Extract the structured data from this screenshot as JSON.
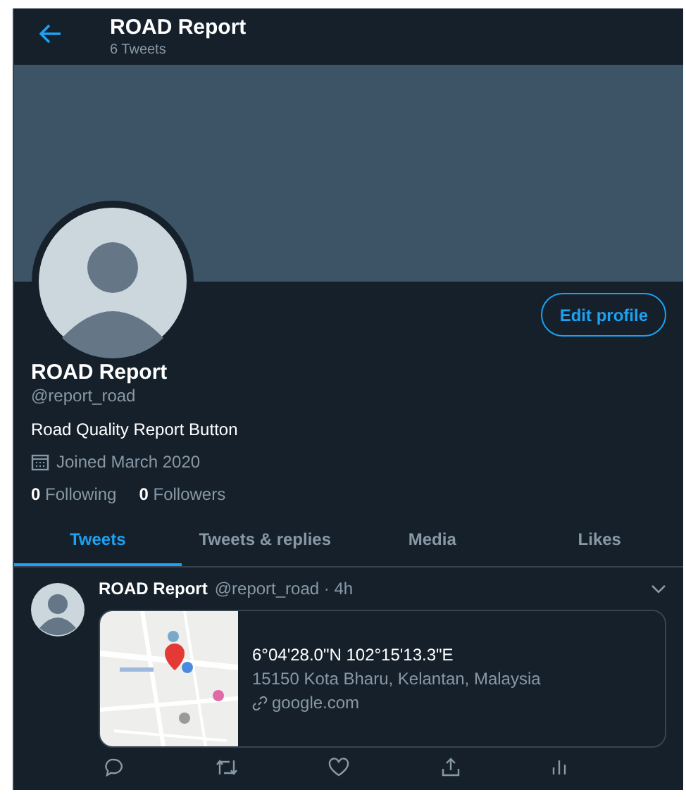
{
  "header": {
    "title": "ROAD Report",
    "subtitle": "6 Tweets"
  },
  "profile": {
    "edit_button": "Edit profile",
    "name": "ROAD Report",
    "handle": "@report_road",
    "bio": "Road Quality Report Button",
    "joined": "Joined March 2020",
    "stats": [
      "**0** Following",
      "**0** Followers"
    ]
  },
  "tabs": [
    {
      "label": "Tweets",
      "selected": true
    },
    {
      "label": "Tweets & replies",
      "selected": false
    },
    {
      "label": "Media",
      "selected": false
    },
    {
      "label": "Likes",
      "selected": false
    }
  ],
  "tweets": [
    {
      "name": "ROAD Report",
      "meta": "@report_road · 4h",
      "card": {
        "title": "6°04'28.0\"N 102°15'13.3\"E",
        "address": "15150 Kota Bharu, Kelantan, Malaysia",
        "link": "google.com"
      }
    }
  ]
}
